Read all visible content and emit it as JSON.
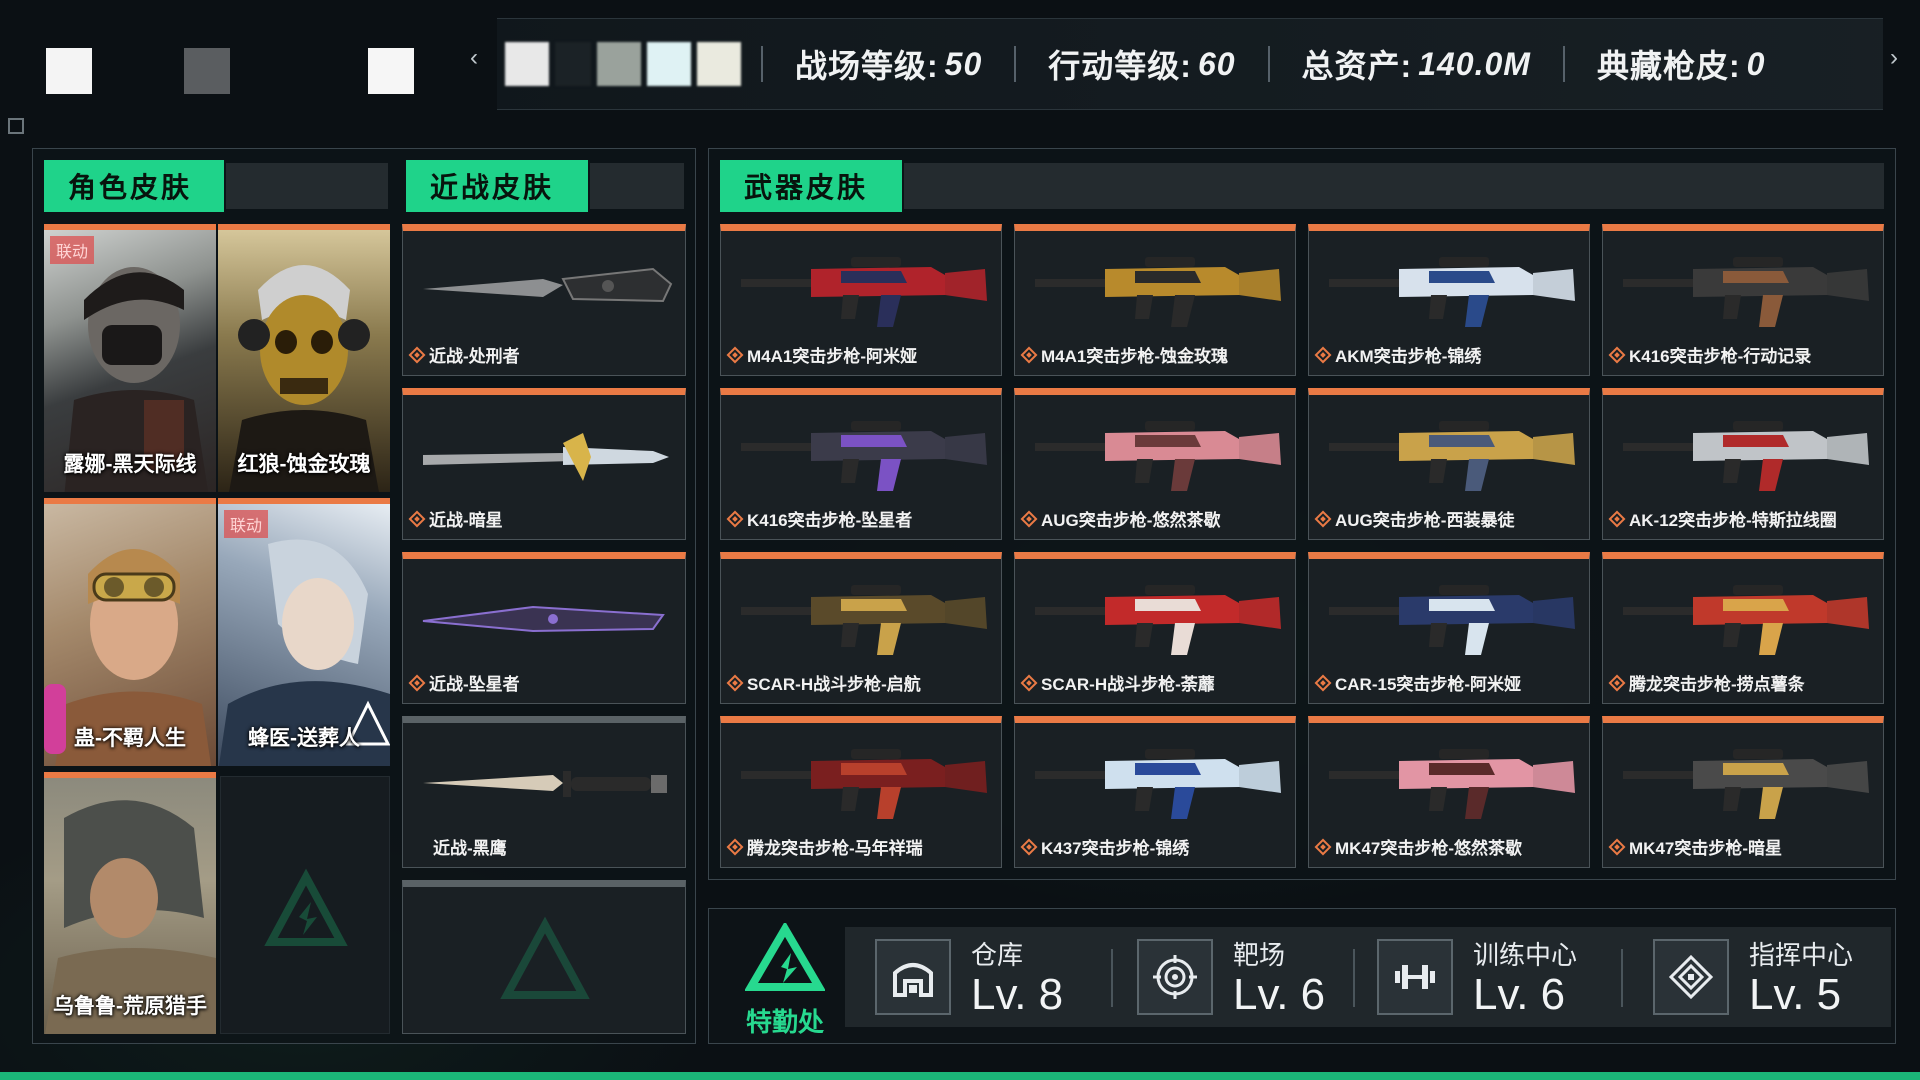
{
  "colors": {
    "accent_green": "#1fd38a",
    "accent_orange": "#ea7a45",
    "panel_bg": "#0e1418"
  },
  "topbar": {
    "stats": [
      {
        "label": "战场等级:",
        "value": "50"
      },
      {
        "label": "行动等级:",
        "value": "60"
      },
      {
        "label": "总资产:",
        "value": "140.0M"
      },
      {
        "label": "典藏枪皮:",
        "value": "0"
      }
    ],
    "left_arrow": "‹",
    "right_arrow": "›"
  },
  "character": {
    "title": "角色皮肤",
    "items": [
      {
        "name": "露娜-黑天际线",
        "badge": "联动"
      },
      {
        "name": "红狼-蚀金玫瑰",
        "badge": ""
      },
      {
        "name": "蛊-不羁人生",
        "badge": ""
      },
      {
        "name": "蜂医-送葬人",
        "badge": "联动"
      },
      {
        "name": "乌鲁鲁-荒原猎手",
        "badge": ""
      }
    ]
  },
  "melee": {
    "title": "近战皮肤",
    "items": [
      {
        "name": "近战-处刑者"
      },
      {
        "name": "近战-暗星"
      },
      {
        "name": "近战-坠星者"
      },
      {
        "name": "近战-黑鹰"
      }
    ]
  },
  "weapons": {
    "title": "武器皮肤",
    "items": [
      {
        "name": "M4A1突击步枪-阿米娅",
        "icon": "rifle-icon"
      },
      {
        "name": "M4A1突击步枪-蚀金玫瑰",
        "icon": "rifle-icon"
      },
      {
        "name": "AKM突击步枪-锦绣",
        "icon": "rifle-icon"
      },
      {
        "name": "K416突击步枪-行动记录",
        "icon": "rifle-icon"
      },
      {
        "name": "K416突击步枪-坠星者",
        "icon": "rifle-icon"
      },
      {
        "name": "AUG突击步枪-悠然茶歇",
        "icon": "rifle-icon"
      },
      {
        "name": "AUG突击步枪-西装暴徒",
        "icon": "rifle-icon"
      },
      {
        "name": "AK-12突击步枪-特斯拉线圈",
        "icon": "rifle-icon"
      },
      {
        "name": "SCAR-H战斗步枪-启航",
        "icon": "rifle-icon"
      },
      {
        "name": "SCAR-H战斗步枪-荼蘼",
        "icon": "rifle-icon"
      },
      {
        "name": "CAR-15突击步枪-阿米娅",
        "icon": "rifle-icon"
      },
      {
        "name": "腾龙突击步枪-捞点薯条",
        "icon": "rifle-icon"
      },
      {
        "name": "腾龙突击步枪-马年祥瑞",
        "icon": "rifle-icon"
      },
      {
        "name": "K437突击步枪-锦绣",
        "icon": "rifle-icon"
      },
      {
        "name": "MK47突击步枪-悠然茶歇",
        "icon": "rifle-icon"
      },
      {
        "name": "MK47突击步枪-暗星",
        "icon": "rifle-icon"
      }
    ]
  },
  "facility": {
    "logo_label": "特勤处",
    "items": [
      {
        "title": "仓库",
        "level": "Lv. 8",
        "icon": "warehouse-icon"
      },
      {
        "title": "靶场",
        "level": "Lv. 6",
        "icon": "target-icon"
      },
      {
        "title": "训练中心",
        "level": "Lv. 6",
        "icon": "dumbbell-icon"
      },
      {
        "title": "指挥中心",
        "level": "Lv. 5",
        "icon": "command-icon"
      }
    ]
  }
}
